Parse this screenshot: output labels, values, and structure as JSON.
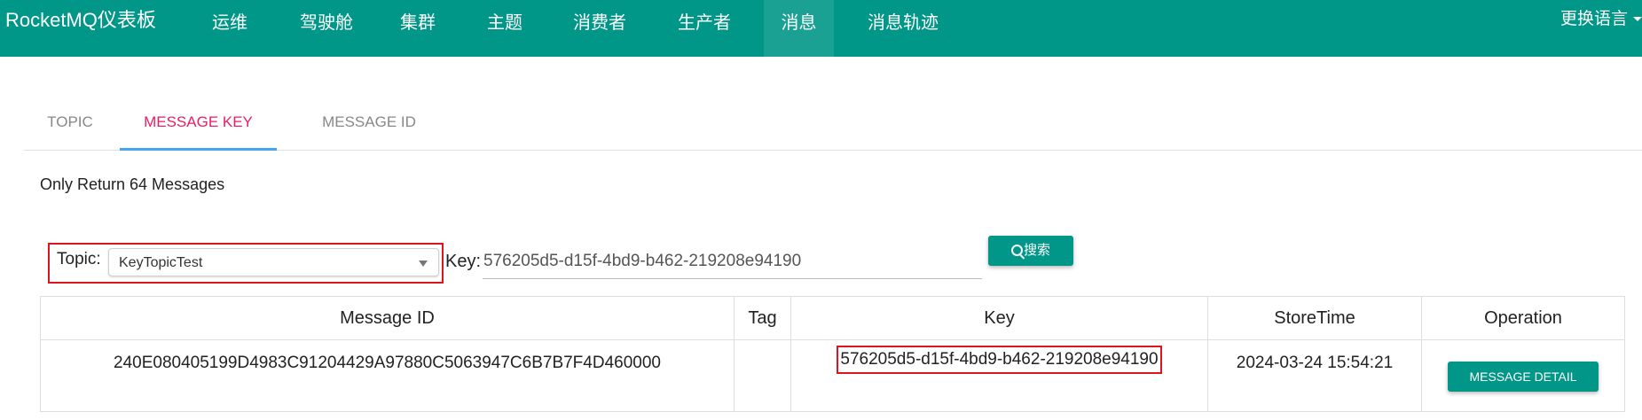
{
  "navbar": {
    "brand": "RocketMQ仪表板",
    "items": [
      {
        "label": "运维"
      },
      {
        "label": "驾驶舱"
      },
      {
        "label": "集群"
      },
      {
        "label": "主题"
      },
      {
        "label": "消费者"
      },
      {
        "label": "生产者"
      },
      {
        "label": "消息"
      },
      {
        "label": "消息轨迹"
      }
    ],
    "active": "消息",
    "language": "更换语言",
    "color": "#009688"
  },
  "tabs": {
    "items": [
      {
        "label": "TOPIC"
      },
      {
        "label": "MESSAGE KEY"
      },
      {
        "label": "MESSAGE ID"
      }
    ],
    "active": "MESSAGE KEY",
    "active_color": "#e91e63",
    "indicator_color": "#42a5f5"
  },
  "summary": "Only Return 64 Messages",
  "search": {
    "topic_label": "Topic:",
    "topic_value": "KeyTopicTest",
    "key_label": "Key:",
    "key_value": "576205d5-d15f-4bd9-b462-219208e94190",
    "button_label": "搜索"
  },
  "table": {
    "columns": [
      "Message ID",
      "Tag",
      "Key",
      "StoreTime",
      "Operation"
    ],
    "rows": [
      {
        "message_id": "240E080405199D4983C91204429A97880C5063947C6B7B7F4D460000",
        "tag": "",
        "key": "576205d5-d15f-4bd9-b462-219208e94190",
        "store_time": "2024-03-24 15:54:21",
        "operation": "MESSAGE DETAIL"
      }
    ]
  },
  "highlight_color": "#e0141e"
}
